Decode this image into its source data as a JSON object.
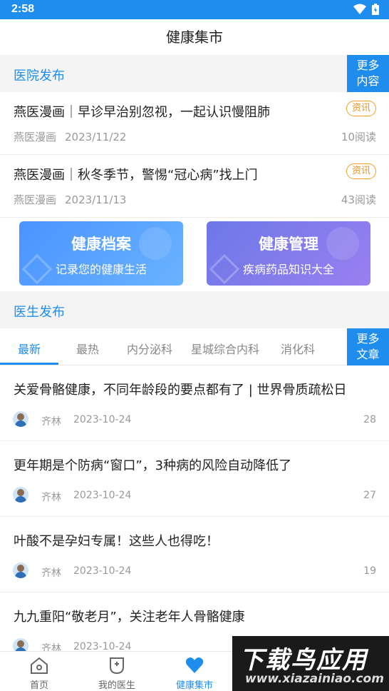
{
  "status": {
    "time": "2:58"
  },
  "page": {
    "title": "健康集市"
  },
  "hospital": {
    "section_title": "医院发布",
    "more_label_1": "更多",
    "more_label_2": "内容",
    "items": [
      {
        "title": "燕医漫画｜早诊早治别忽视，一起认识慢阻肺",
        "tag": "资讯",
        "source": "燕医漫画",
        "date": "2023/11/22",
        "reads": "10阅读"
      },
      {
        "title": "燕医漫画｜秋冬季节，警惕“冠心病”找上门",
        "tag": "资讯",
        "source": "燕医漫画",
        "date": "2023/11/13",
        "reads": "43阅读"
      }
    ]
  },
  "cards": [
    {
      "title": "健康档案",
      "subtitle": "记录您的健康生活"
    },
    {
      "title": "健康管理",
      "subtitle": "疾病药品知识大全"
    }
  ],
  "doctor": {
    "section_title": "医生发布",
    "more_label_1": "更多",
    "more_label_2": "文章",
    "tabs": [
      "最新",
      "最热",
      "内分泌科",
      "星城综合内科",
      "消化科"
    ],
    "articles": [
      {
        "title": "关爱骨骼健康，不同年龄段的要点都有了 | 世界骨质疏松日",
        "author": "齐林",
        "date": "2023-10-24",
        "count": "28"
      },
      {
        "title": "更年期是个防病“窗口”，3种病的风险自动降低了",
        "author": "齐林",
        "date": "2023-10-24",
        "count": "27"
      },
      {
        "title": "叶酸不是孕妇专属！这些人也得吃！",
        "author": "齐林",
        "date": "2023-10-24",
        "count": "19"
      },
      {
        "title": "九九重阳“敬老月”，关注老年人骨骼健康",
        "author": "齐林",
        "date": "2023-10-24",
        "count": ""
      }
    ]
  },
  "tabbar": [
    {
      "label": "首页",
      "icon": "home-icon"
    },
    {
      "label": "我的医生",
      "icon": "doctor-icon"
    },
    {
      "label": "健康集市",
      "icon": "heart-icon"
    }
  ],
  "watermark": {
    "big": "下载鸟应用",
    "small": "www.xiazainiao.com"
  },
  "colors": {
    "accent": "#1f8ded",
    "tag": "#e8951a"
  }
}
